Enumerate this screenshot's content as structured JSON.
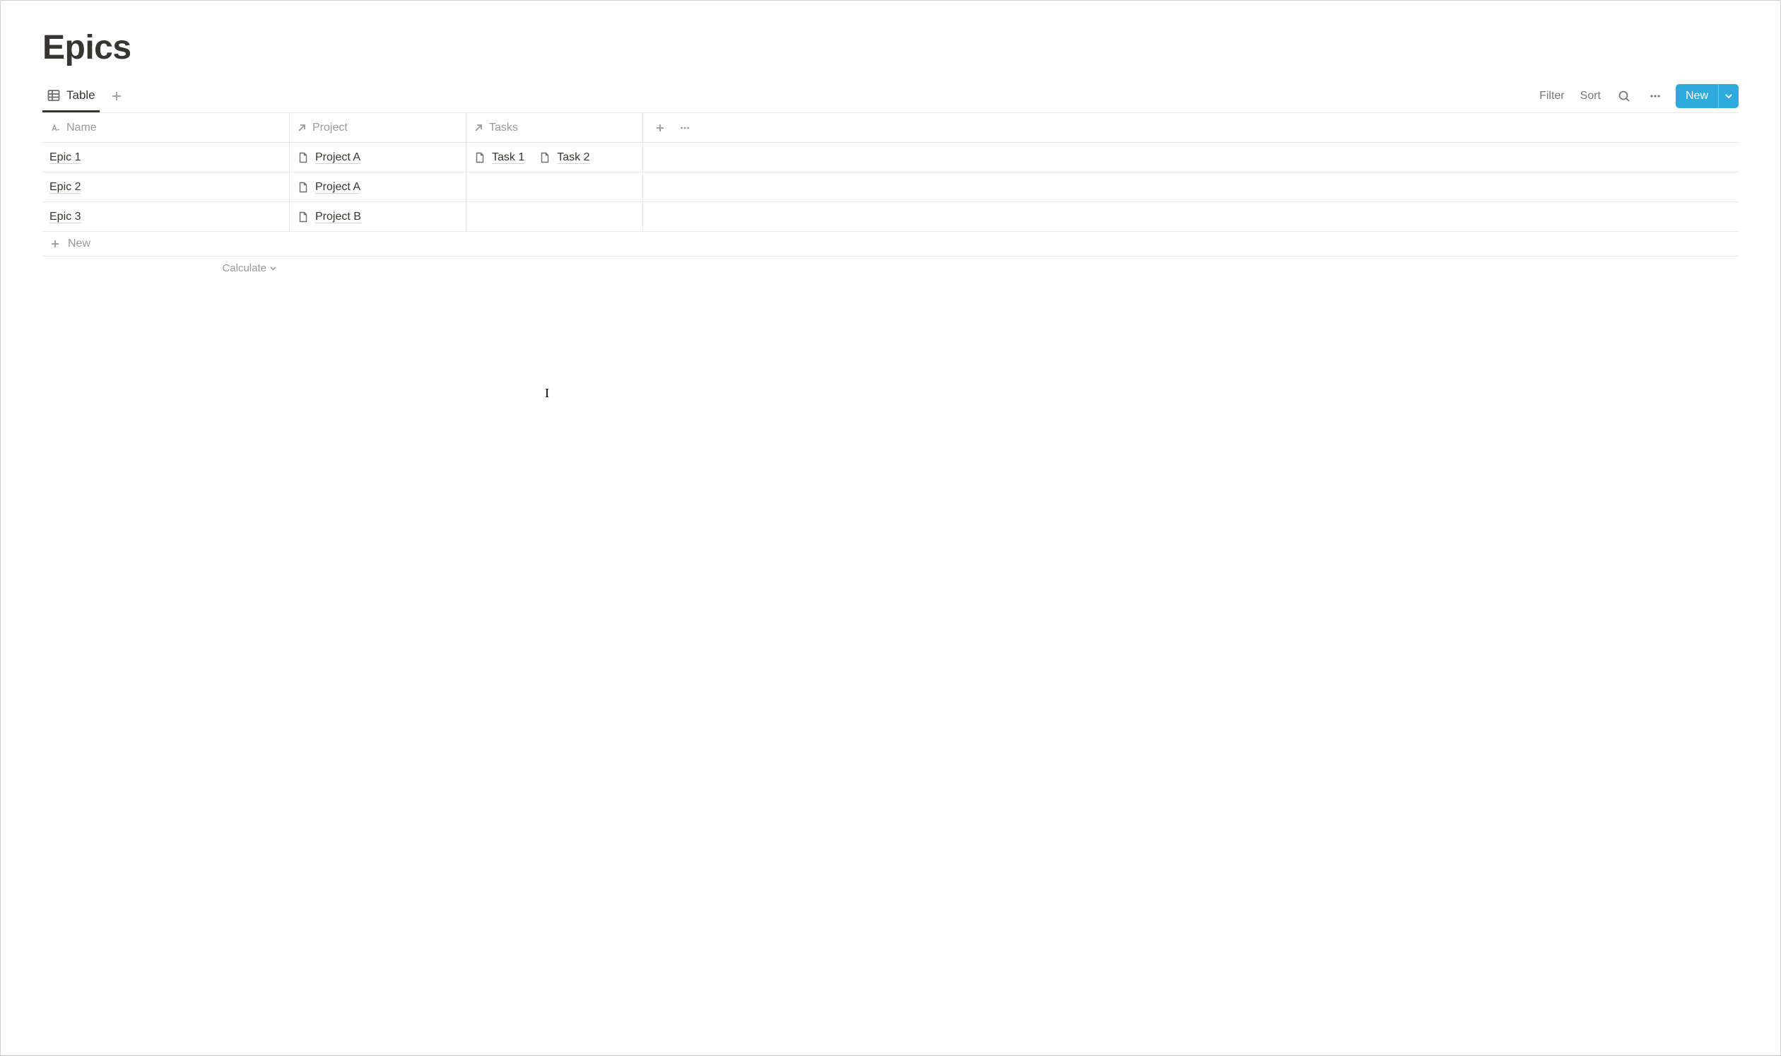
{
  "page": {
    "title": "Epics"
  },
  "tabs": {
    "table": "Table"
  },
  "controls": {
    "filter": "Filter",
    "sort": "Sort",
    "new": "New"
  },
  "columns": {
    "name": "Name",
    "project": "Project",
    "tasks": "Tasks"
  },
  "rows": [
    {
      "name": "Epic 1",
      "project": "Project A",
      "tasks": [
        "Task 1",
        "Task 2"
      ]
    },
    {
      "name": "Epic 2",
      "project": "Project A",
      "tasks": []
    },
    {
      "name": "Epic 3",
      "project": "Project B",
      "tasks": []
    }
  ],
  "new_row": "New",
  "calculate": "Calculate"
}
